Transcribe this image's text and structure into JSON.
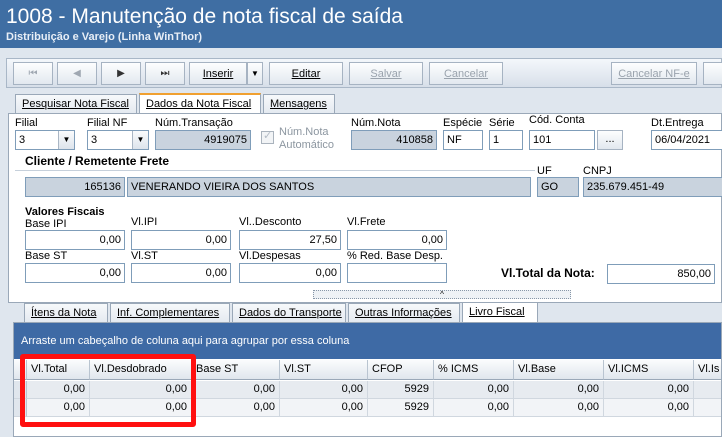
{
  "window": {
    "title": "1008 - Manutenção de nota fiscal de saída",
    "subtitle": "Distribuição e Varejo (Linha WinThor)"
  },
  "toolbar": {
    "first": "⏮",
    "prev": "◀",
    "next": "▶",
    "last": "⏭",
    "insert_label": "Inserir",
    "insert_dropdown": "▼",
    "edit_label": "Editar",
    "save_label": "Salvar",
    "cancel_label": "Cancelar",
    "cancel_nfe_label": "Cancelar NF-e"
  },
  "tabs": [
    {
      "label": "Pesquisar Nota Fiscal"
    },
    {
      "label": "Dados da Nota Fiscal"
    },
    {
      "label": "Mensagens"
    }
  ],
  "form": {
    "filial_label": "Filial",
    "filial_value": "3",
    "filial_nf_label": "Filial NF",
    "filial_nf_value": "3",
    "num_transacao_label": "Núm.Transação",
    "num_transacao_value": "4919075",
    "num_nota_automatico_label_1": "Núm.Nota",
    "num_nota_automatico_label_2": "Automático",
    "num_nota_label": "Núm.Nota",
    "num_nota_value": "410858",
    "especie_label": "Espécie",
    "especie_value": "NF",
    "serie_label": "Série",
    "serie_value": "1",
    "cod_conta_label": "Cód. Conta",
    "cod_conta_value": "101",
    "lookup_button": "...",
    "dt_entrega_label": "Dt.Entrega",
    "dt_entrega_value": "06/04/2021",
    "cliente_section": "Cliente / Remetente Frete",
    "cliente_codigo": "165136",
    "cliente_nome": "VENERANDO VIEIRA DOS SANTOS",
    "uf_label": "UF",
    "uf_value": "GO",
    "cnpj_label": "CNPJ",
    "cnpj_value": "235.679.451-49",
    "valores_section": "Valores Fiscais",
    "base_ipi_label": "Base IPI",
    "base_ipi_value": "0,00",
    "vl_ipi_label": "Vl.IPI",
    "vl_ipi_value": "0,00",
    "vl_desconto_label": "Vl..Desconto",
    "vl_desconto_value": "27,50",
    "vl_frete_label": "Vl.Frete",
    "vl_frete_value": "0,00",
    "base_st_label": "Base ST",
    "base_st_value": "0,00",
    "vl_st_label": "Vl.ST",
    "vl_st_value": "0,00",
    "vl_despesas_label": "Vl.Despesas",
    "vl_despesas_value": "0,00",
    "red_base_label": "% Red. Base Desp.",
    "red_base_value": "",
    "vl_total_label": "Vl.Total da Nota:",
    "vl_total_value": "850,00"
  },
  "splitter": {
    "glyph": "^"
  },
  "bottom_tabs": [
    {
      "label": "Ítens da Nota"
    },
    {
      "label": "Inf. Complementares"
    },
    {
      "label": "Dados do Transporte"
    },
    {
      "label": "Outras Informações"
    },
    {
      "label": "Livro Fiscal"
    }
  ],
  "grid": {
    "group_hint": "Arraste um cabeçalho de coluna aqui para agrupar por essa coluna",
    "columns": [
      "Vl.Total",
      "Vl.Desdobrado",
      "Base ST",
      "Vl.ST",
      "CFOP",
      "% ICMS",
      "Vl.Base",
      "Vl.ICMS",
      "Vl.Is"
    ],
    "rows": [
      [
        "0,00",
        "0,00",
        "0,00",
        "0,00",
        "5929",
        "0,00",
        "0,00",
        "0,00",
        ""
      ],
      [
        "0,00",
        "0,00",
        "0,00",
        "0,00",
        "5929",
        "0,00",
        "0,00",
        "0,00",
        ""
      ]
    ]
  },
  "colors": {
    "title_bar": "#3f6ea3",
    "group_bar": "#3e6aa5",
    "highlight": "#ff1010"
  }
}
